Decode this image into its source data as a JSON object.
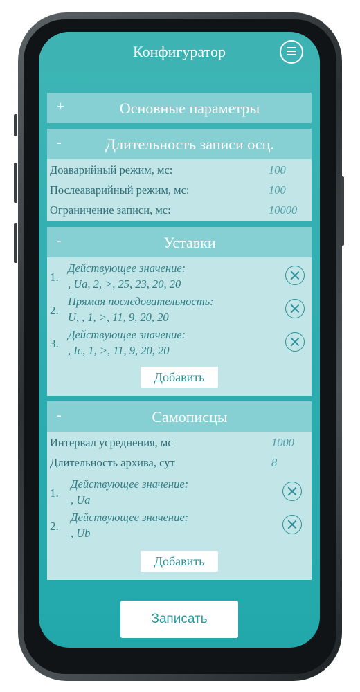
{
  "app": {
    "title": "Конфигуратор",
    "menu_icon": "menu-icon"
  },
  "sections": {
    "basic": {
      "sign": "+",
      "title": "Основные параметры"
    },
    "duration": {
      "sign": "-",
      "title": "Длительность записи осц.",
      "rows": [
        {
          "label": "Доаварийный режим, мс:",
          "value": "100"
        },
        {
          "label": "Послеаварийный режим, мс:",
          "value": "100"
        },
        {
          "label": "Ограничение записи, мс:",
          "value": "10000"
        }
      ]
    },
    "settings": {
      "sign": "-",
      "title": "Уставки",
      "items": [
        {
          "num": "1.",
          "line1": "Действующее значение:",
          "line2": ", Ua, 2, >, 25, 23, 20, 20"
        },
        {
          "num": "2.",
          "line1": "Прямая последовательность:",
          "line2": "U, , 1, >, 11, 9, 20, 20"
        },
        {
          "num": "3.",
          "line1": "Действующее значение:",
          "line2": ", Ic, 1, >, 11, 9, 20, 20"
        }
      ],
      "add_label": "Добавить"
    },
    "recorders": {
      "sign": "-",
      "title": "Самописцы",
      "rows": [
        {
          "label": "Интервал усреднения, мс",
          "value": "1000"
        },
        {
          "label": "Длительность архива, сут",
          "value": "8"
        }
      ],
      "items": [
        {
          "num": "1.",
          "line1": "Действующее значение:",
          "line2": ", Ua"
        },
        {
          "num": "2.",
          "line1": "Действующее значение:",
          "line2": ", Ub"
        }
      ],
      "add_label": "Добавить"
    }
  },
  "write_label": "Записать",
  "colors": {
    "accent": "#2eadb0",
    "panel_header": "#86cfd2",
    "panel_body": "#c2e6e8",
    "text": "#2f7f86"
  }
}
